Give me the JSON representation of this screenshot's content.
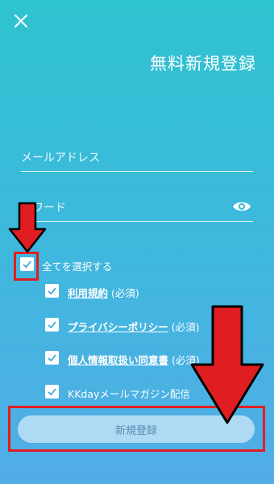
{
  "header": {
    "close_icon": "close-icon",
    "title": "無料新規登録"
  },
  "form": {
    "email_placeholder": "メールアドレス",
    "password_placeholder": "スワード",
    "password_toggle_icon": "eye-icon"
  },
  "consents": {
    "select_all": {
      "label": "全てを選択する",
      "checked": true
    },
    "items": [
      {
        "link": "利用規約",
        "suffix": " (必須)",
        "checked": true
      },
      {
        "link": "プライバシーポリシー",
        "suffix": " (必須)",
        "checked": true
      },
      {
        "link": "個人情報取扱い同意書",
        "suffix": " (必須)",
        "checked": true
      },
      {
        "text": "KKdayメールマガジン配信",
        "checked": true
      }
    ]
  },
  "submit": {
    "label": "新規登録"
  },
  "colors": {
    "background_top": "#2fc3d0",
    "background_bottom": "#52ace6",
    "annotation_red": "#e01e22",
    "checkmark": "#3aa8dc"
  }
}
